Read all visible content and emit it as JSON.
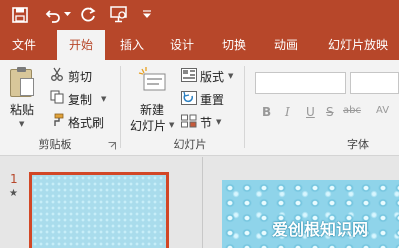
{
  "tabs": [
    "文件",
    "开始",
    "插入",
    "设计",
    "切换",
    "动画",
    "幻灯片放映"
  ],
  "active_tab": "开始",
  "clipboard": {
    "paste": "粘贴",
    "cut": "剪切",
    "copy": "复制",
    "format_painter": "格式刷",
    "group_label": "剪贴板"
  },
  "slides_group": {
    "new_slide_line1": "新建",
    "new_slide_line2": "幻灯片",
    "layout": "版式",
    "reset": "重置",
    "section": "节",
    "group_label": "幻灯片"
  },
  "font_group": {
    "bold": "B",
    "italic": "I",
    "underline": "U",
    "strike": "S",
    "shadow": "abc",
    "spacing": "AV",
    "group_label": "字体"
  },
  "slide_pane": {
    "slide_number": "1",
    "star": "★"
  },
  "watermark": "爱创根知识网",
  "colors": {
    "accent": "#b7472a",
    "selection": "#d24726"
  }
}
